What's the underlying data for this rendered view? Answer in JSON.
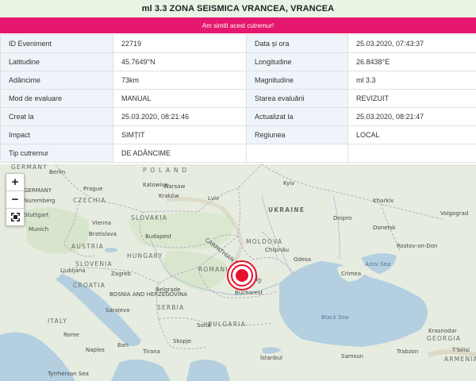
{
  "header": {
    "title": "ml 3.3 ZONA SEISMICA VRANCEA, VRANCEA",
    "felt_button": "Am simtit acest cutremur!"
  },
  "details": [
    {
      "label": "ID Eveniment",
      "value": "22719",
      "label2": "Data și ora",
      "value2": "25.03.2020, 07:43:37"
    },
    {
      "label": "Latitudine",
      "value": "45.7649°N",
      "label2": "Longitudine",
      "value2": "26.8438°E"
    },
    {
      "label": "Adâncime",
      "value": "73km",
      "label2": "Magnitudine",
      "value2": "ml 3.3"
    },
    {
      "label": "Mod de evaluare",
      "value": "MANUAL",
      "label2": "Starea evaluării",
      "value2": "REVIZUIT"
    },
    {
      "label": "Creat la",
      "value": "25.03.2020, 08:21:46",
      "label2": "Actualizat la",
      "value2": "25.03.2020, 08:21:47"
    },
    {
      "label": "Impact",
      "value": "SIMȚIT",
      "label2": "Regiunea",
      "value2": "LOCAL"
    },
    {
      "label": "Tip cutremur",
      "value": "DE ADÂNCIME",
      "label2": "",
      "value2": ""
    }
  ],
  "map": {
    "zoom_in": "+",
    "zoom_out": "−",
    "fullscreen_icon": "fullscreen-icon",
    "epicenter_color": "#e8112d",
    "labels": {
      "germany": "GERMANY",
      "berlin": "Berlin",
      "poland": "P O L A N D",
      "kyiv": "Kyiv",
      "kharkiv": "Kharkiv",
      "warsaw": "Warsaw",
      "prague": "Prague",
      "czechia": "CZECHIA",
      "katowice": "Katowice",
      "krakow": "Kraków",
      "lviv": "Lviv",
      "ukraine": "UKRAINE",
      "nuremberg": "Nuremberg",
      "stuttgart": "Stuttgart",
      "munich": "Munich",
      "vienna": "Vienna",
      "bratislava": "Bratislava",
      "slovakia": "SLOVAKIA",
      "austria": "AUSTRIA",
      "budapest": "Budapest",
      "hungary": "HUNGARY",
      "slovenia": "SLOVENIA",
      "ljubljana": "Ljubljana",
      "zagreb": "Zagreb",
      "croatia": "CROATIA",
      "bosnia": "BOSNIA AND HERZEGOVINA",
      "sarajevo": "Sarajevo",
      "belgrade": "Belgrade",
      "serbia": "SERBIA",
      "italy": "ITALY",
      "rome": "Rome",
      "naples": "Naples",
      "bari": "Bari",
      "tirana": "Tirana",
      "skopje": "Skopje",
      "sofia": "Sofia",
      "bulgaria": "BULGARIA",
      "romania": "ROMANIA",
      "bucharest": "Bucharest",
      "moldova": "MOLDOVA",
      "chisinau": "Chișinău",
      "odesa": "Odesa",
      "dnipro": "Dnipro",
      "donetsk": "Donetsk",
      "rostov": "Rostov-on-Don",
      "volgograd": "Volgograd",
      "azov_sea": "Azov Sea",
      "black_sea": "Black Sea",
      "crimea": "Crimea",
      "carpathian": "CARPATHIAN MOUNTAINS",
      "tyrrhenian": "Tyrrhenian Sea",
      "krasnodar": "Krasnodar",
      "georgia": "GEORGIA",
      "armenia": "ARMENIA",
      "istanbul": "İstanbul",
      "samsun": "Samsun",
      "trabzon": "Trabzon",
      "tbilisi": "T'bilisi"
    }
  }
}
